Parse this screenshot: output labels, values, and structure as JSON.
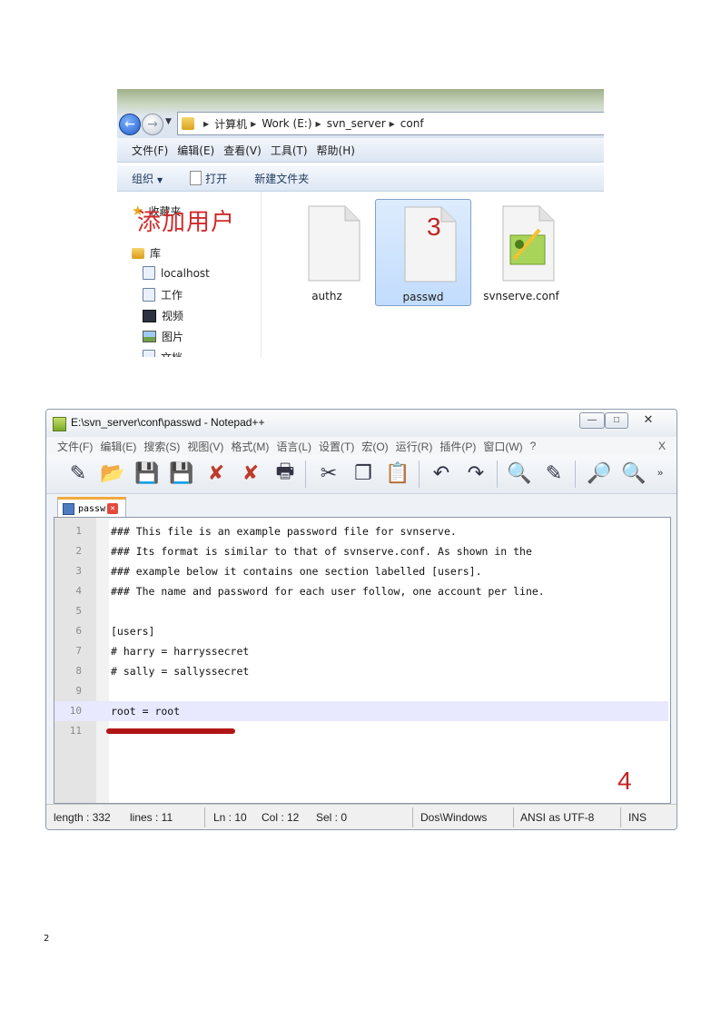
{
  "explorer": {
    "breadcrumb": [
      "计算机",
      "Work (E:)",
      "svn_server",
      "conf"
    ],
    "menu": [
      "文件(F)",
      "编辑(E)",
      "查看(V)",
      "工具(T)",
      "帮助(H)"
    ],
    "commands": {
      "organize": "组织",
      "open": "打开",
      "new_folder": "新建文件夹"
    },
    "nav": {
      "favorites": "收藏夹",
      "libraries": "库",
      "items": [
        "localhost",
        "工作",
        "视频",
        "图片",
        "文档"
      ]
    },
    "files": [
      {
        "name": "authz",
        "selected": false
      },
      {
        "name": "passwd",
        "selected": true
      },
      {
        "name": "svnserve.conf",
        "selected": false
      }
    ],
    "caption": "添加用户",
    "step": "3"
  },
  "notepad": {
    "title": "E:\\svn_server\\conf\\passwd - Notepad++",
    "menu": [
      "文件(F)",
      "编辑(E)",
      "搜索(S)",
      "视图(V)",
      "格式(M)",
      "语言(L)",
      "设置(T)",
      "宏(O)",
      "运行(R)",
      "插件(P)",
      "窗口(W)",
      "?"
    ],
    "menu_close": "X",
    "tab_label": "passw",
    "lines": [
      {
        "num": "1",
        "text": "### This file is an example password file for svnserve."
      },
      {
        "num": "2",
        "text": "### Its format is similar to that of svnserve.conf. As shown in the"
      },
      {
        "num": "3",
        "text": "### example below it contains one section labelled [users]."
      },
      {
        "num": "4",
        "text": "### The name and password for each user follow, one account per line."
      },
      {
        "num": "5",
        "text": ""
      },
      {
        "num": "6",
        "text": "[users]"
      },
      {
        "num": "7",
        "text": "# harry = harryssecret"
      },
      {
        "num": "8",
        "text": "# sally = sallyssecret"
      },
      {
        "num": "9",
        "text": ""
      },
      {
        "num": "10",
        "text": "root = root"
      },
      {
        "num": "11",
        "text": ""
      }
    ],
    "current_line": 10,
    "step": "4",
    "status": {
      "length": "length : 332",
      "lines": "lines : 11",
      "ln": "Ln : 10",
      "col": "Col : 12",
      "sel": "Sel : 0",
      "eol": "Dos\\Windows",
      "encoding": "ANSI as UTF-8",
      "mode": "INS"
    }
  },
  "page_number": "2"
}
